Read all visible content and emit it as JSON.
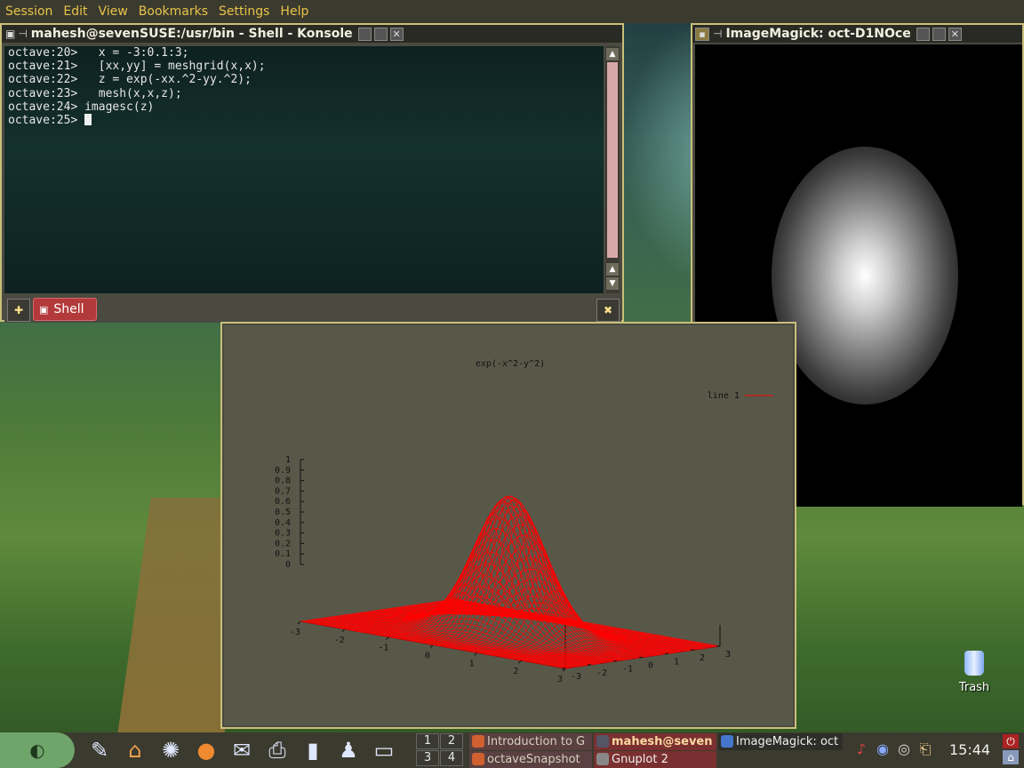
{
  "menubar": {
    "items": [
      "Session",
      "Edit",
      "View",
      "Bookmarks",
      "Settings",
      "Help"
    ]
  },
  "konsole": {
    "title": "mahesh@sevenSUSE:/usr/bin - Shell - Konsole",
    "lines": [
      "octave:20>   x = -3:0.1:3;",
      "octave:21>   [xx,yy] = meshgrid(x,x);",
      "octave:22>   z = exp(-xx.^2-yy.^2);",
      "octave:23>   mesh(x,x,z);",
      "octave:24> imagesc(z)",
      "octave:25> "
    ],
    "tab_label": "Shell"
  },
  "imagemagick": {
    "title": "ImageMagick: oct-D1NOce"
  },
  "gnuplot": {
    "plot_title": "exp(-x^2-y^2)",
    "legend": "line 1",
    "chart_data": {
      "type": "surface-mesh",
      "title": "exp(-x^2-y^2)",
      "series": [
        {
          "name": "line 1",
          "color": "#ff0000"
        }
      ],
      "z_ticks": [
        "0",
        "0.1",
        "0.2",
        "0.3",
        "0.4",
        "0.5",
        "0.6",
        "0.7",
        "0.8",
        "0.9",
        "1"
      ],
      "x_ticks": [
        "-3",
        "-2",
        "-1",
        "0",
        "1",
        "2",
        "3"
      ],
      "y_ticks": [
        "-3",
        "-2",
        "-1",
        "0",
        "1",
        "2",
        "3"
      ],
      "xlim": [
        -3,
        3
      ],
      "ylim": [
        -3,
        3
      ],
      "zlim": [
        0,
        1
      ]
    }
  },
  "desktop": {
    "trash_label": "Trash"
  },
  "taskbar": {
    "pager": [
      "1",
      "2",
      "3",
      "4"
    ],
    "tasks": [
      {
        "label": "Introduction to G",
        "color": "#d06030"
      },
      {
        "label": "mahesh@seven",
        "color": "#556"
      },
      {
        "label": "ImageMagick: oct",
        "color": "#4477cc"
      },
      {
        "label": "octaveSnapshot",
        "color": "#d06030"
      },
      {
        "label": "Gnuplot 2",
        "color": "#888"
      }
    ],
    "clock": "15:44"
  }
}
